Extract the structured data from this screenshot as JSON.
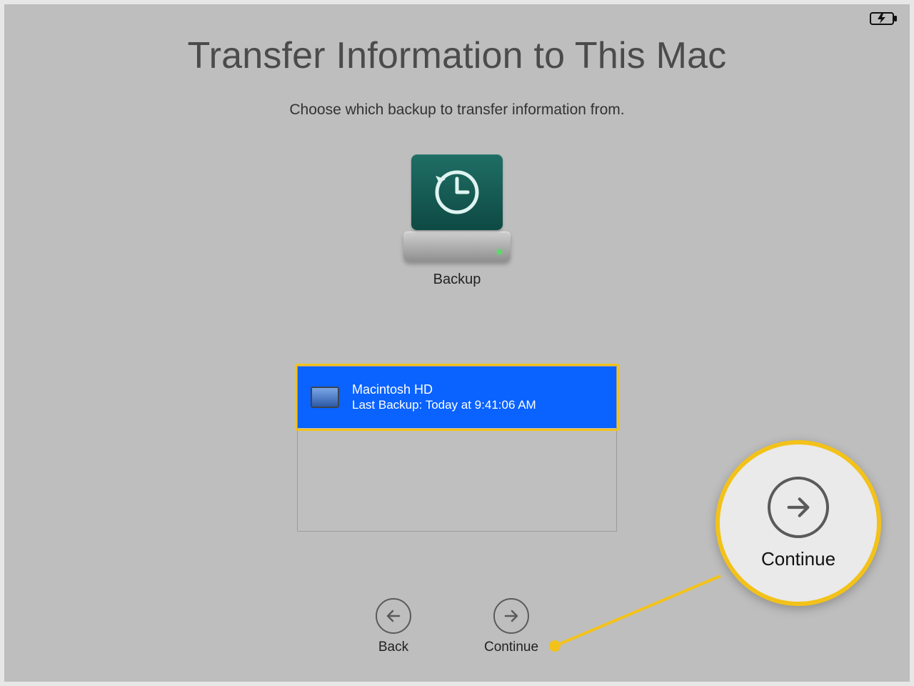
{
  "title": "Transfer Information to This Mac",
  "subtitle": "Choose which backup to transfer information from.",
  "drive": {
    "label": "Backup"
  },
  "backup": {
    "name": "Macintosh HD",
    "meta": "Last Backup: Today at 9:41:06 AM"
  },
  "nav": {
    "back": "Back",
    "continue": "Continue"
  },
  "callout": {
    "label": "Continue"
  }
}
